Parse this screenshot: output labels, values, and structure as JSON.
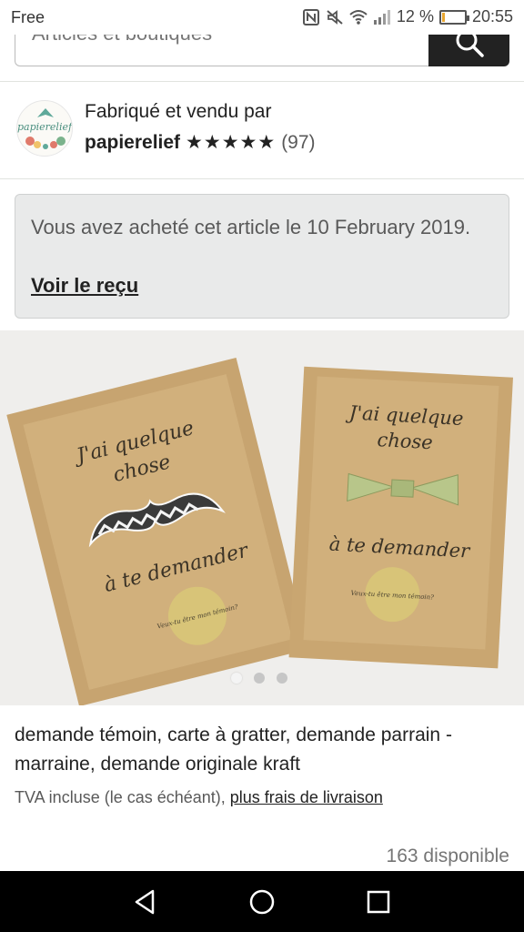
{
  "status_bar": {
    "carrier": "Free",
    "battery_percent": "12 %",
    "battery_level": 0.12,
    "time": "20:55",
    "icons": [
      "nfc-icon",
      "mute-icon",
      "wifi-icon",
      "signal-icon",
      "battery-icon"
    ]
  },
  "search": {
    "placeholder": "Articles et boutiques",
    "button_icon": "search-icon"
  },
  "shop": {
    "byline": "Fabriqué et vendu par",
    "name": "papierelief",
    "stars": "★★★★★",
    "rating": 5,
    "review_count": "(97)",
    "logo_text": "papierelief"
  },
  "purchase_notice": {
    "text": "Vous avez acheté cet article le 10 February 2019.",
    "link": "Voir le reçu"
  },
  "product_image": {
    "card_left": {
      "line1": "J'ai quelque",
      "line2": "chose",
      "line3": "à te demander",
      "sticker": "Veux-tu être mon témoin?"
    },
    "card_right": {
      "line1": "J'ai quelque",
      "line2": "chose",
      "line3": "à te demander",
      "sticker": "Veux-tu être mon témoin?"
    },
    "carousel": {
      "count": 3,
      "active_index": 0
    }
  },
  "product": {
    "title": "demande témoin, carte à gratter, demande parrain - marraine, demande originale kraft",
    "tax_prefix": "TVA incluse (le cas échéant), ",
    "shipping_link": "plus frais de livraison",
    "stock": "163 disponible"
  },
  "nav_bar": {
    "icons": [
      "back-icon",
      "home-icon",
      "recents-icon"
    ]
  },
  "colors": {
    "kraft": "#c9a671",
    "kraft_dark": "#b8925c",
    "notice_bg": "#e9eaea",
    "nav_bg": "#000000",
    "gold": "#d8c478"
  }
}
